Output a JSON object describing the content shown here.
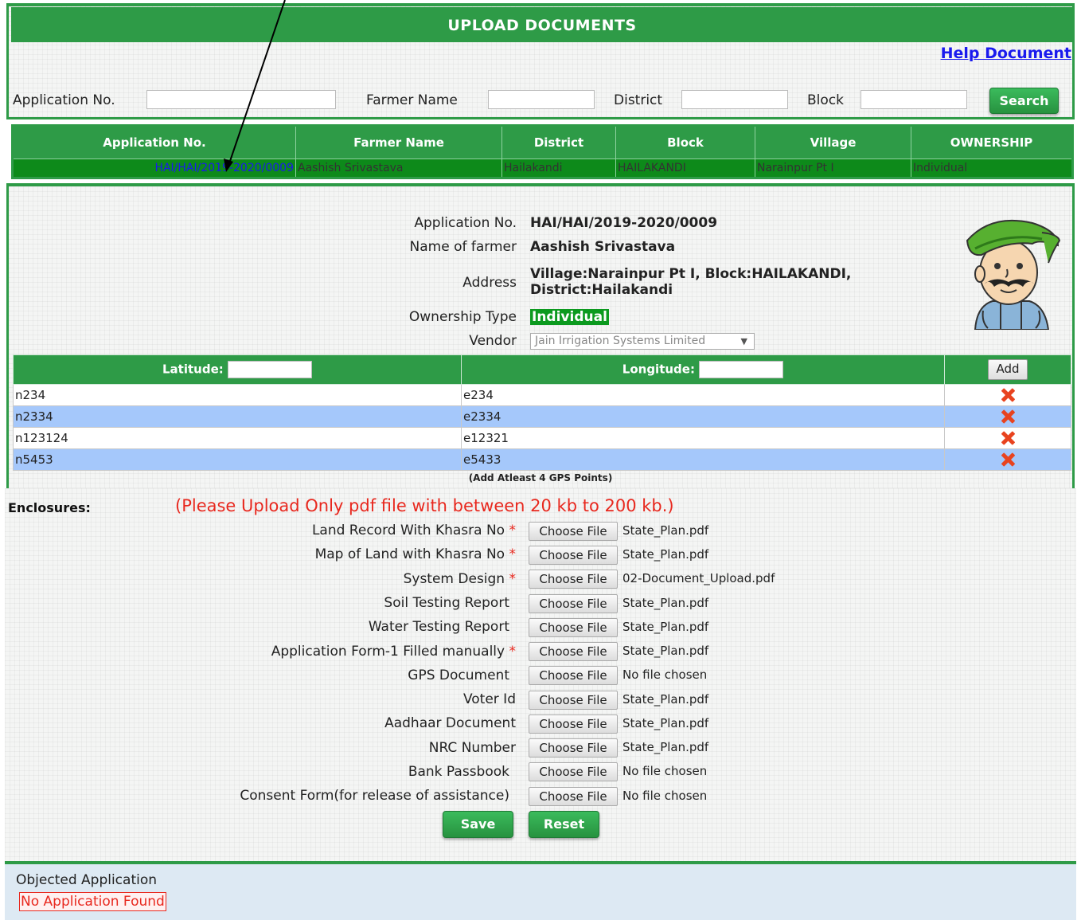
{
  "header": {
    "title": "UPLOAD DOCUMENTS",
    "help_link": "Help Document"
  },
  "search": {
    "application_no_label": "Application No.",
    "farmer_name_label": "Farmer Name",
    "district_label": "District",
    "block_label": "Block",
    "search_button": "Search"
  },
  "results": {
    "columns": [
      "Application No.",
      "Farmer Name",
      "District",
      "Block",
      "Village",
      "OWNERSHIP"
    ],
    "rows": [
      [
        "HAI/HAI/2019-2020/0009",
        "Aashish Srivastava",
        "Hailakandi",
        "HAILAKANDI",
        "Narainpur Pt I",
        "Individual"
      ]
    ]
  },
  "details": {
    "application_no_label": "Application No.",
    "application_no": "HAI/HAI/2019-2020/0009",
    "farmer_name_label": "Name of farmer",
    "farmer_name": "Aashish Srivastava",
    "address_label": "Address",
    "address_line1": "Village:Narainpur Pt I, Block:HAILAKANDI,",
    "address_line2": "District:Hailakandi",
    "ownership_label": "Ownership Type",
    "ownership": "Individual",
    "vendor_label": "Vendor",
    "vendor": "Jain Irrigation Systems Limited"
  },
  "gps": {
    "latitude_label": "Latitude:",
    "longitude_label": "Longitude:",
    "add_button": "Add",
    "rows": [
      {
        "lat": "n234",
        "lng": "e234"
      },
      {
        "lat": "n2334",
        "lng": "e2334"
      },
      {
        "lat": "n123124",
        "lng": "e12321"
      },
      {
        "lat": "n5453",
        "lng": "e5433"
      }
    ],
    "note": "(Add Atleast 4 GPS Points)"
  },
  "enclosures": {
    "title": "Enclosures:",
    "note": "(Please Upload Only pdf file with between 20 kb to 200 kb.)",
    "choose_label": "Choose File",
    "required_mark": "*",
    "items": [
      {
        "label": "Land Record With Khasra No",
        "required": true,
        "file": "State_Plan.pdf"
      },
      {
        "label": "Map of Land with Khasra No",
        "required": true,
        "file": "State_Plan.pdf"
      },
      {
        "label": "System Design",
        "required": true,
        "file": "02-Document_Upload.pdf"
      },
      {
        "label": "Soil Testing Report",
        "required": false,
        "file": "State_Plan.pdf"
      },
      {
        "label": "Water Testing Report",
        "required": false,
        "file": "State_Plan.pdf"
      },
      {
        "label": "Application Form-1 Filled manually",
        "required": true,
        "file": "State_Plan.pdf"
      },
      {
        "label": "GPS Document",
        "required": false,
        "file": "No file chosen"
      },
      {
        "label": "Voter Id",
        "required": false,
        "file": "State_Plan.pdf"
      },
      {
        "label": "Aadhaar Document",
        "required": false,
        "file": "State_Plan.pdf"
      },
      {
        "label": "NRC Number",
        "required": false,
        "file": "State_Plan.pdf"
      },
      {
        "label": "Bank Passbook",
        "required": false,
        "file": "No file chosen"
      },
      {
        "label": "Consent Form(for release of assistance)",
        "required": false,
        "file": "No file chosen"
      }
    ],
    "save_button": "Save",
    "reset_button": "Reset"
  },
  "objected": {
    "title": "Objected Application",
    "empty_message": "No Application Found"
  },
  "colors": {
    "brand_green": "#2e9b47",
    "row_blue": "#a5c8fb",
    "required_red": "#e8281e",
    "link_blue": "#1a1aee"
  },
  "icons": {
    "delete": "delete-x-icon",
    "farmer_avatar": "farmer-avatar-icon",
    "dropdown": "chevron-down-icon"
  }
}
